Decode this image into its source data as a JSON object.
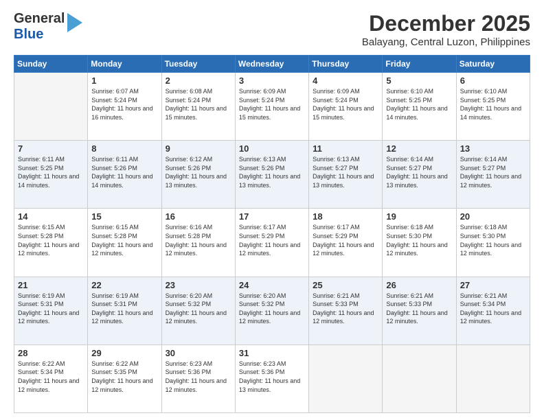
{
  "logo": {
    "general": "General",
    "blue": "Blue"
  },
  "header": {
    "title": "December 2025",
    "subtitle": "Balayang, Central Luzon, Philippines"
  },
  "weekdays": [
    "Sunday",
    "Monday",
    "Tuesday",
    "Wednesday",
    "Thursday",
    "Friday",
    "Saturday"
  ],
  "weeks": [
    [
      {
        "day": "",
        "sunrise": "",
        "sunset": "",
        "daylight": ""
      },
      {
        "day": "1",
        "sunrise": "Sunrise: 6:07 AM",
        "sunset": "Sunset: 5:24 PM",
        "daylight": "Daylight: 11 hours and 16 minutes."
      },
      {
        "day": "2",
        "sunrise": "Sunrise: 6:08 AM",
        "sunset": "Sunset: 5:24 PM",
        "daylight": "Daylight: 11 hours and 15 minutes."
      },
      {
        "day": "3",
        "sunrise": "Sunrise: 6:09 AM",
        "sunset": "Sunset: 5:24 PM",
        "daylight": "Daylight: 11 hours and 15 minutes."
      },
      {
        "day": "4",
        "sunrise": "Sunrise: 6:09 AM",
        "sunset": "Sunset: 5:24 PM",
        "daylight": "Daylight: 11 hours and 15 minutes."
      },
      {
        "day": "5",
        "sunrise": "Sunrise: 6:10 AM",
        "sunset": "Sunset: 5:25 PM",
        "daylight": "Daylight: 11 hours and 14 minutes."
      },
      {
        "day": "6",
        "sunrise": "Sunrise: 6:10 AM",
        "sunset": "Sunset: 5:25 PM",
        "daylight": "Daylight: 11 hours and 14 minutes."
      }
    ],
    [
      {
        "day": "7",
        "sunrise": "Sunrise: 6:11 AM",
        "sunset": "Sunset: 5:25 PM",
        "daylight": "Daylight: 11 hours and 14 minutes."
      },
      {
        "day": "8",
        "sunrise": "Sunrise: 6:11 AM",
        "sunset": "Sunset: 5:26 PM",
        "daylight": "Daylight: 11 hours and 14 minutes."
      },
      {
        "day": "9",
        "sunrise": "Sunrise: 6:12 AM",
        "sunset": "Sunset: 5:26 PM",
        "daylight": "Daylight: 11 hours and 13 minutes."
      },
      {
        "day": "10",
        "sunrise": "Sunrise: 6:13 AM",
        "sunset": "Sunset: 5:26 PM",
        "daylight": "Daylight: 11 hours and 13 minutes."
      },
      {
        "day": "11",
        "sunrise": "Sunrise: 6:13 AM",
        "sunset": "Sunset: 5:27 PM",
        "daylight": "Daylight: 11 hours and 13 minutes."
      },
      {
        "day": "12",
        "sunrise": "Sunrise: 6:14 AM",
        "sunset": "Sunset: 5:27 PM",
        "daylight": "Daylight: 11 hours and 13 minutes."
      },
      {
        "day": "13",
        "sunrise": "Sunrise: 6:14 AM",
        "sunset": "Sunset: 5:27 PM",
        "daylight": "Daylight: 11 hours and 12 minutes."
      }
    ],
    [
      {
        "day": "14",
        "sunrise": "Sunrise: 6:15 AM",
        "sunset": "Sunset: 5:28 PM",
        "daylight": "Daylight: 11 hours and 12 minutes."
      },
      {
        "day": "15",
        "sunrise": "Sunrise: 6:15 AM",
        "sunset": "Sunset: 5:28 PM",
        "daylight": "Daylight: 11 hours and 12 minutes."
      },
      {
        "day": "16",
        "sunrise": "Sunrise: 6:16 AM",
        "sunset": "Sunset: 5:28 PM",
        "daylight": "Daylight: 11 hours and 12 minutes."
      },
      {
        "day": "17",
        "sunrise": "Sunrise: 6:17 AM",
        "sunset": "Sunset: 5:29 PM",
        "daylight": "Daylight: 11 hours and 12 minutes."
      },
      {
        "day": "18",
        "sunrise": "Sunrise: 6:17 AM",
        "sunset": "Sunset: 5:29 PM",
        "daylight": "Daylight: 11 hours and 12 minutes."
      },
      {
        "day": "19",
        "sunrise": "Sunrise: 6:18 AM",
        "sunset": "Sunset: 5:30 PM",
        "daylight": "Daylight: 11 hours and 12 minutes."
      },
      {
        "day": "20",
        "sunrise": "Sunrise: 6:18 AM",
        "sunset": "Sunset: 5:30 PM",
        "daylight": "Daylight: 11 hours and 12 minutes."
      }
    ],
    [
      {
        "day": "21",
        "sunrise": "Sunrise: 6:19 AM",
        "sunset": "Sunset: 5:31 PM",
        "daylight": "Daylight: 11 hours and 12 minutes."
      },
      {
        "day": "22",
        "sunrise": "Sunrise: 6:19 AM",
        "sunset": "Sunset: 5:31 PM",
        "daylight": "Daylight: 11 hours and 12 minutes."
      },
      {
        "day": "23",
        "sunrise": "Sunrise: 6:20 AM",
        "sunset": "Sunset: 5:32 PM",
        "daylight": "Daylight: 11 hours and 12 minutes."
      },
      {
        "day": "24",
        "sunrise": "Sunrise: 6:20 AM",
        "sunset": "Sunset: 5:32 PM",
        "daylight": "Daylight: 11 hours and 12 minutes."
      },
      {
        "day": "25",
        "sunrise": "Sunrise: 6:21 AM",
        "sunset": "Sunset: 5:33 PM",
        "daylight": "Daylight: 11 hours and 12 minutes."
      },
      {
        "day": "26",
        "sunrise": "Sunrise: 6:21 AM",
        "sunset": "Sunset: 5:33 PM",
        "daylight": "Daylight: 11 hours and 12 minutes."
      },
      {
        "day": "27",
        "sunrise": "Sunrise: 6:21 AM",
        "sunset": "Sunset: 5:34 PM",
        "daylight": "Daylight: 11 hours and 12 minutes."
      }
    ],
    [
      {
        "day": "28",
        "sunrise": "Sunrise: 6:22 AM",
        "sunset": "Sunset: 5:34 PM",
        "daylight": "Daylight: 11 hours and 12 minutes."
      },
      {
        "day": "29",
        "sunrise": "Sunrise: 6:22 AM",
        "sunset": "Sunset: 5:35 PM",
        "daylight": "Daylight: 11 hours and 12 minutes."
      },
      {
        "day": "30",
        "sunrise": "Sunrise: 6:23 AM",
        "sunset": "Sunset: 5:36 PM",
        "daylight": "Daylight: 11 hours and 12 minutes."
      },
      {
        "day": "31",
        "sunrise": "Sunrise: 6:23 AM",
        "sunset": "Sunset: 5:36 PM",
        "daylight": "Daylight: 11 hours and 13 minutes."
      },
      {
        "day": "",
        "sunrise": "",
        "sunset": "",
        "daylight": ""
      },
      {
        "day": "",
        "sunrise": "",
        "sunset": "",
        "daylight": ""
      },
      {
        "day": "",
        "sunrise": "",
        "sunset": "",
        "daylight": ""
      }
    ]
  ]
}
